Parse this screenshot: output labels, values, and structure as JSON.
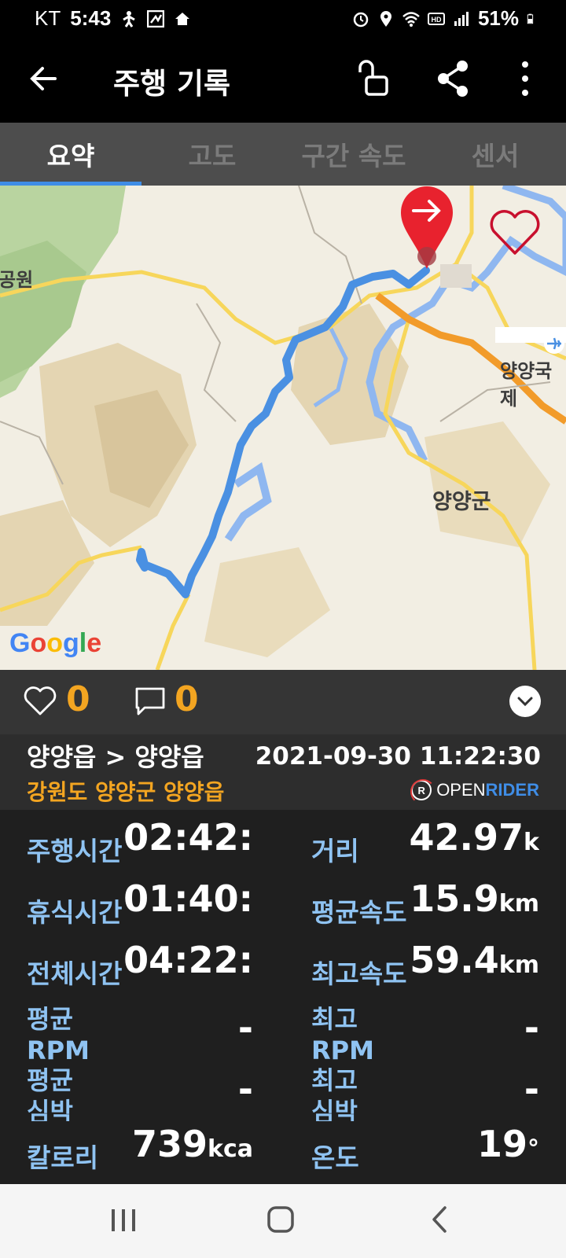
{
  "status_bar": {
    "carrier": "KT",
    "time": "5:43",
    "battery": "51%"
  },
  "app_bar": {
    "title": "주행 기록"
  },
  "tabs": [
    {
      "label": "요약",
      "active": true
    },
    {
      "label": "고도",
      "active": false
    },
    {
      "label": "구간 속도",
      "active": false
    },
    {
      "label": "센서",
      "active": false
    }
  ],
  "map": {
    "labels": {
      "park": "공원",
      "airport": "양양국제",
      "county": "양양군"
    },
    "attribution": "Google",
    "route_color": "#4a90e2",
    "pin_color": "#e8222e"
  },
  "social": {
    "likes": "0",
    "comments": "0"
  },
  "route": {
    "name": "양양읍 > 양양읍",
    "datetime": "2021-09-30 11:22:30",
    "region": "강원도 양양군 양양읍",
    "brand_open": "OPEN",
    "brand_rider": "RIDER"
  },
  "stats": {
    "ride_time_label": "주행시간",
    "ride_time_value": "02:42:",
    "distance_label": "거리",
    "distance_value": "42.97",
    "distance_unit": "k",
    "rest_time_label": "휴식시간",
    "rest_time_value": "01:40:",
    "avg_speed_label": "평균속도",
    "avg_speed_value": "15.9",
    "avg_speed_unit": "km",
    "total_time_label": "전체시간",
    "total_time_value": "04:22:",
    "max_speed_label": "최고속도",
    "max_speed_value": "59.4",
    "max_speed_unit": "km",
    "avg_rpm_label": "평균 RPM",
    "avg_rpm_value": "-",
    "max_rpm_label": "최고 RPM",
    "max_rpm_value": "-",
    "avg_hr_label": "평균 심박",
    "avg_hr_value": "-",
    "max_hr_label": "최고 심박",
    "max_hr_value": "-",
    "calories_label": "칼로리",
    "calories_value": "739",
    "calories_unit": "kca",
    "temp_label": "온도",
    "temp_value": "19",
    "temp_unit": "°"
  }
}
